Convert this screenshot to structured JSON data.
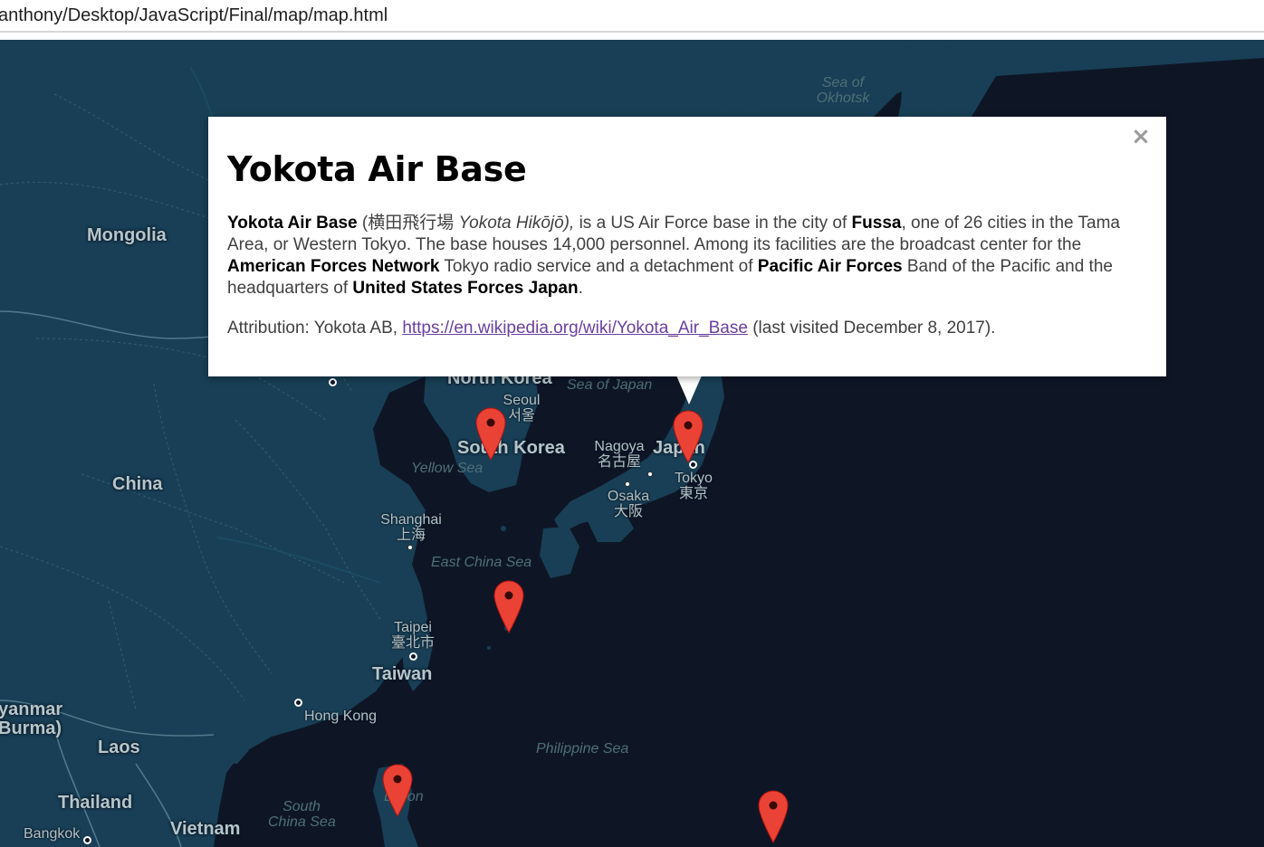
{
  "browser": {
    "address": "anthony/Desktop/JavaScript/Final/map/map.html"
  },
  "map": {
    "labels": {
      "sea_of_okhotsk": "Sea of\nOkhotsk",
      "mongolia": "Mongolia",
      "china": "China",
      "north_korea": "North Korea",
      "south_korea": "South Korea",
      "japan": "Japan",
      "sea_of_japan": "Sea of Japan",
      "seoul": "Seoul\n서울",
      "yellow_sea": "Yellow Sea",
      "nagoya": "Nagoya\n名古屋",
      "tokyo": "Tokyo\n東京",
      "osaka": "Osaka\n大阪",
      "shanghai": "Shanghai\n上海",
      "east_china_sea": "East China Sea",
      "taipei": "Taipei\n臺北市",
      "taiwan": "Taiwan",
      "hong_kong": "Hong Kong",
      "myanmar": "yanmar\nBurma)",
      "laos": "Laos",
      "thailand": "Thailand",
      "bangkok": "Bangkok",
      "vietnam": "Vietnam",
      "south_china_sea": "South\nChina Sea",
      "philippine_sea": "Philippine Sea",
      "luzon": "Luzon"
    },
    "colors": {
      "land": "#183f55",
      "water": "#0e1626",
      "border": "#3c6378",
      "marker": "#ea4335"
    }
  },
  "info_window": {
    "title": "Yokota Air Base",
    "body": {
      "name": "Yokota Air Base",
      "native_open": " (横田飛行場 ",
      "romaji": "Yokota Hikōjō),",
      "text1": " is a US Air Force base in the city of ",
      "fussa": "Fussa",
      "text2": ", one of 26 cities in the Tama Area, or Western Tokyo. The base houses 14,000 personnel. Among its facilities are the broadcast center for the ",
      "afn": "American Forces Network",
      "text3": " Tokyo radio service and a detachment of ",
      "paf": "Pacific Air Forces",
      "text4": " Band of the Pacific and the headquarters of ",
      "usfj": "United States Forces Japan",
      "text5": "."
    },
    "attribution": {
      "prefix": "Attribution: Yokota AB, ",
      "link": "https://en.wikipedia.org/wiki/Yokota_Air_Base",
      "suffix": " (last visited December 8, 2017)."
    },
    "close_label": "×"
  }
}
